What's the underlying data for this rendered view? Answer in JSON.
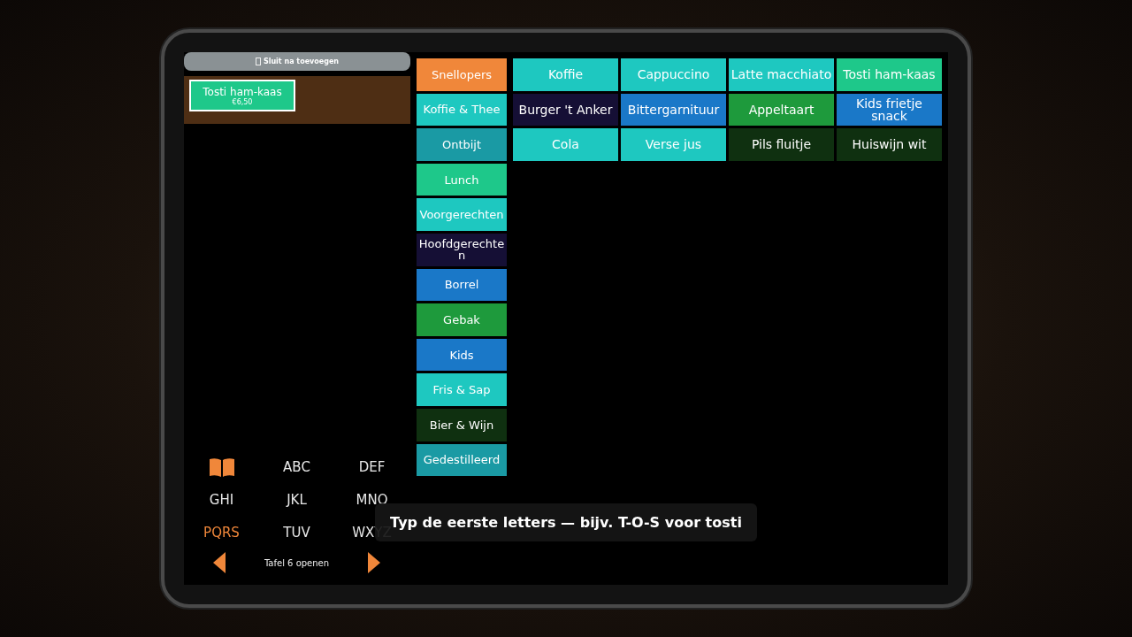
{
  "close_after_add": {
    "label": "Sluit na toevoegen"
  },
  "order_lines": [
    {
      "name": "Tosti ham-kaas",
      "price": "€6,50",
      "color": "#1ec88a"
    }
  ],
  "keypad": [
    {
      "kind": "book",
      "selected": true
    },
    {
      "kind": "letters",
      "label": "ABC",
      "selected": false
    },
    {
      "kind": "letters",
      "label": "DEF",
      "selected": false
    },
    {
      "kind": "letters",
      "label": "GHI",
      "selected": false
    },
    {
      "kind": "letters",
      "label": "JKL",
      "selected": false
    },
    {
      "kind": "letters",
      "label": "MNO",
      "selected": false
    },
    {
      "kind": "letters",
      "label": "PQRS",
      "selected": true
    },
    {
      "kind": "letters",
      "label": "TUV",
      "selected": false
    },
    {
      "kind": "letters",
      "label": "WXYZ",
      "selected": false
    }
  ],
  "table_nav": {
    "label": "Tafel 6 openen"
  },
  "categories": [
    {
      "label": "Snellopers",
      "color": "#f0873a"
    },
    {
      "label": "Koffie & Thee",
      "color": "#1ec8c0"
    },
    {
      "label": "Ontbijt",
      "color": "#1a9aa4"
    },
    {
      "label": "Lunch",
      "color": "#1ec88a"
    },
    {
      "label": "Voorgerechten",
      "color": "#1ec8c0"
    },
    {
      "label": "Hoofdgerechten",
      "color": "#150f35"
    },
    {
      "label": "Borrel",
      "color": "#1a78c8"
    },
    {
      "label": "Gebak",
      "color": "#1e9a3c"
    },
    {
      "label": "Kids",
      "color": "#1a78c8"
    },
    {
      "label": "Fris & Sap",
      "color": "#1ec8c0"
    },
    {
      "label": "Bier & Wijn",
      "color": "#0f3010"
    },
    {
      "label": "Gedestilleerd",
      "color": "#1a9aa4"
    }
  ],
  "products": [
    {
      "label": "Koffie",
      "color": "#1ec8c0"
    },
    {
      "label": "Cappuccino",
      "color": "#1ec8c0"
    },
    {
      "label": "Latte macchiato",
      "color": "#1ec8c0"
    },
    {
      "label": "Tosti ham-kaas",
      "color": "#1ec88a"
    },
    {
      "label": "Burger 't Anker",
      "color": "#150f35"
    },
    {
      "label": "Bittergarnituur",
      "color": "#1a78c8"
    },
    {
      "label": "Appeltaart",
      "color": "#1e9a3c"
    },
    {
      "label": "Kids frietje snack",
      "color": "#1a78c8"
    },
    {
      "label": "Cola",
      "color": "#1ec8c0"
    },
    {
      "label": "Verse jus",
      "color": "#1ec8c0"
    },
    {
      "label": "Pils fluitje",
      "color": "#0f3010"
    },
    {
      "label": "Huiswijn wit",
      "color": "#0f3010"
    }
  ],
  "toast": {
    "text": "Typ de eerste letters — bijv. T-O-S voor tosti"
  }
}
